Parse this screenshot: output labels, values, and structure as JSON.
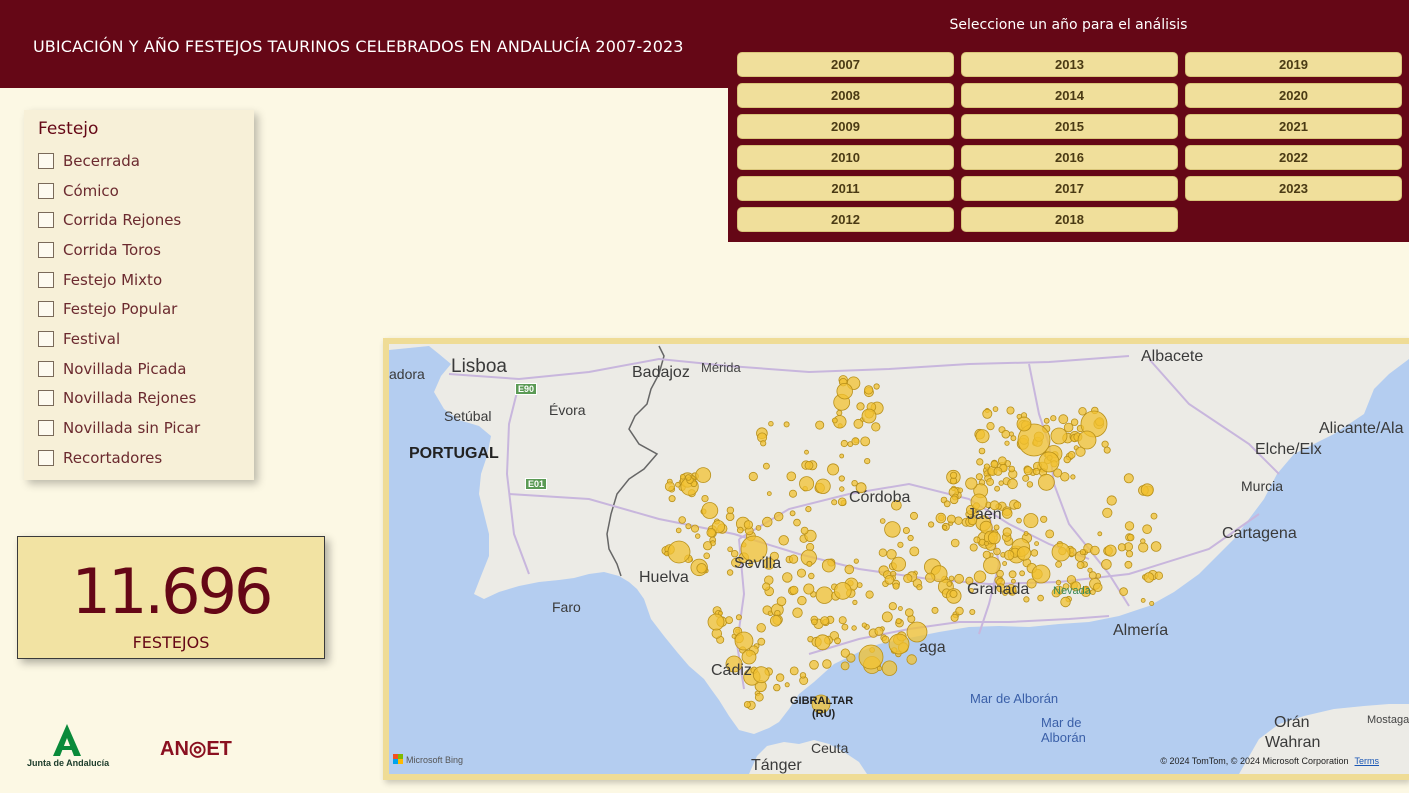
{
  "header": {
    "title": "UBICACIÓN Y AÑO FESTEJOS TAURINOS CELEBRADOS EN ANDALUCÍA 2007-2023"
  },
  "year_selector": {
    "prompt": "Seleccione un año para el análisis",
    "years": [
      "2007",
      "2008",
      "2009",
      "2010",
      "2011",
      "2012",
      "2013",
      "2014",
      "2015",
      "2016",
      "2017",
      "2018",
      "2019",
      "2020",
      "2021",
      "2022",
      "2023"
    ]
  },
  "filter": {
    "title": "Festejo",
    "items": [
      "Becerrada",
      "Cómico",
      "Corrida Rejones",
      "Corrida Toros",
      "Festejo Mixto",
      "Festejo Popular",
      "Festival",
      "Novillada Picada",
      "Novillada Rejones",
      "Novillada sin Picar",
      "Recortadores"
    ]
  },
  "kpi": {
    "value": "11.696",
    "label": "FESTEJOS"
  },
  "logos": {
    "junta": "Junta de Andalucía",
    "anoet": "AN◎ET"
  },
  "map": {
    "labels": {
      "lisboa": "Lisboa",
      "badajoz": "Badajoz",
      "merida": "Mérida",
      "albacete": "Albacete",
      "adora": "adora",
      "setubal": "Setúbal",
      "evora": "Évora",
      "portugal": "PORTUGAL",
      "cordoba": "Córdoba",
      "jaen": "Jaén",
      "murcia": "Murcia",
      "elche": "Elche/Elx",
      "alicante": "Alicante/Ala",
      "cartagena": "Cartagena",
      "sevilla": "Sevilla",
      "huelva": "Huelva",
      "faro": "Faro",
      "granada": "Granada",
      "nevada": "Nevada",
      "almeria": "Almería",
      "malaga": "aga",
      "cadiz": "Cádiz",
      "gibraltar": "GIBRALTAR",
      "gibraltar_ru": "(RU)",
      "alboran1": "Mar de Alborán",
      "alboran2_a": "Mar de",
      "alboran2_b": "Alborán",
      "oran": "Orán",
      "wahran": "Wahran",
      "mostaga": "Mostaga",
      "ceuta": "Ceuta",
      "tanger": "Tánger"
    },
    "roads": {
      "e90": "E90",
      "e01": "E01"
    },
    "bing": "Microsoft Bing",
    "attribution": "© 2024 TomTom, © 2024 Microsoft Corporation",
    "terms": "Terms",
    "colors": {
      "bubble_fill": "#f1c232",
      "bubble_stroke": "#b8901a",
      "land": "#ecebe6",
      "sea": "#b4cdf0"
    }
  }
}
